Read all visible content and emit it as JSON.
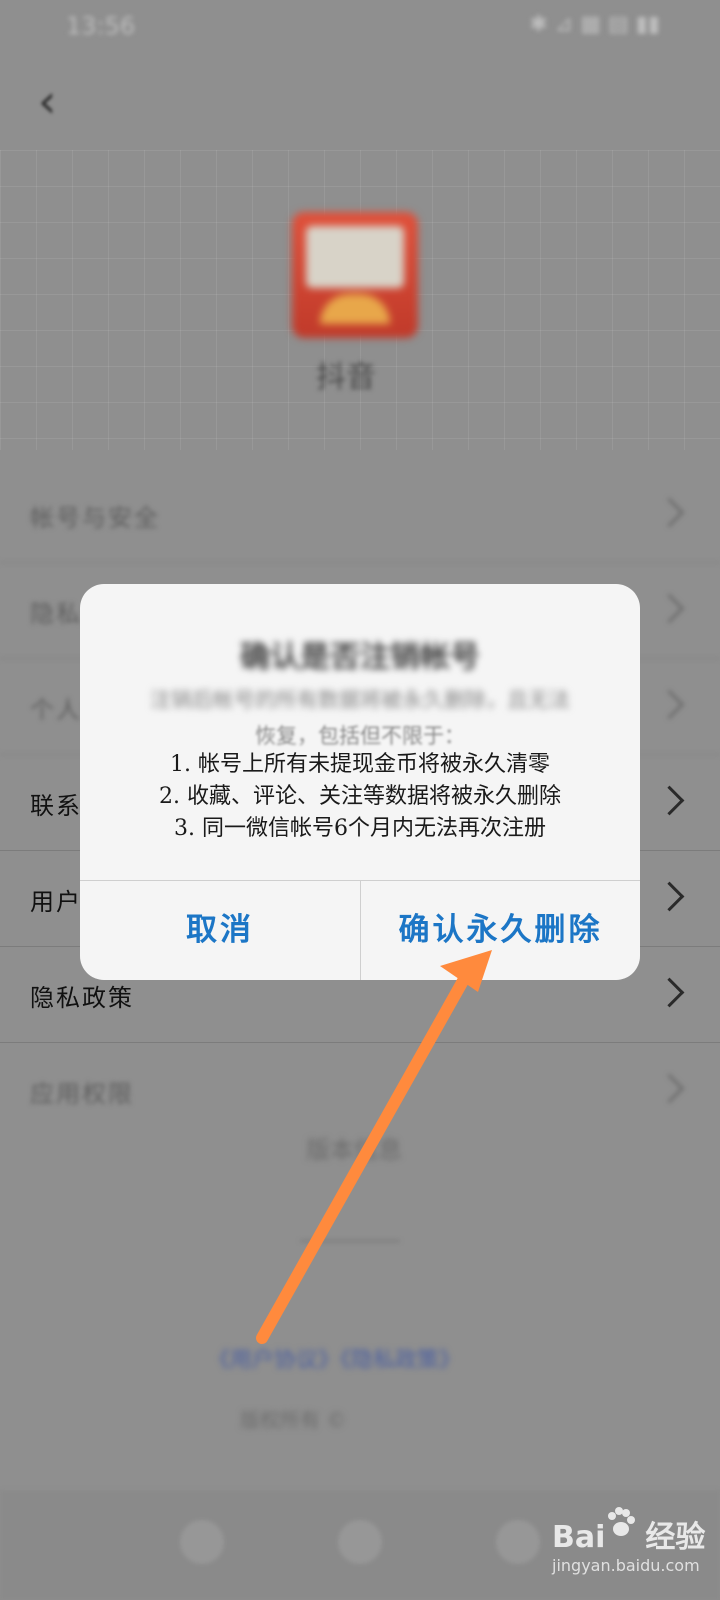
{
  "status_bar": {
    "time": "13:56",
    "icons": "✱ ⊿ ▦ ▤ ▮▮"
  },
  "nav": {
    "back_icon": "chevron-left-icon",
    "back_glyph": "‹"
  },
  "app": {
    "name": "抖音"
  },
  "settings_rows": [
    {
      "label": "帐号与安全",
      "blurred": true
    },
    {
      "label": "隐私设置",
      "blurred": true
    },
    {
      "label": "个人信息",
      "blurred": true
    },
    {
      "label": "联系客服",
      "blurred": false
    },
    {
      "label": "用户协议",
      "blurred": false
    },
    {
      "label": "隐私政策",
      "blurred": false
    },
    {
      "label": "应用权限",
      "blurred": true
    }
  ],
  "footer": {
    "version": "版本信息",
    "links": "《用户协议》《隐私政策》",
    "copyright": "版权所有 ©"
  },
  "dialog": {
    "title": "确认是否注销帐号",
    "intro_line1": "注销后帐号的所有数据将被永久删除，且无法",
    "intro_line2": "恢复，包括但不限于：",
    "items": [
      "1. 帐号上所有未提现金币将被永久清零",
      "2. 收藏、评论、关注等数据将被永久删除",
      "3. 同一微信帐号6个月内无法再次注册"
    ],
    "cancel_label": "取消",
    "confirm_label": "确认永久删除"
  },
  "annotation": {
    "arrow_color": "#ff8a3d"
  },
  "watermark": {
    "brand": "Bai",
    "brand_suffix": "经验",
    "site": "jingyan.baidu.com"
  },
  "colors": {
    "dialog_button": "#1c76c6",
    "overlay": "#8f8f8f"
  }
}
